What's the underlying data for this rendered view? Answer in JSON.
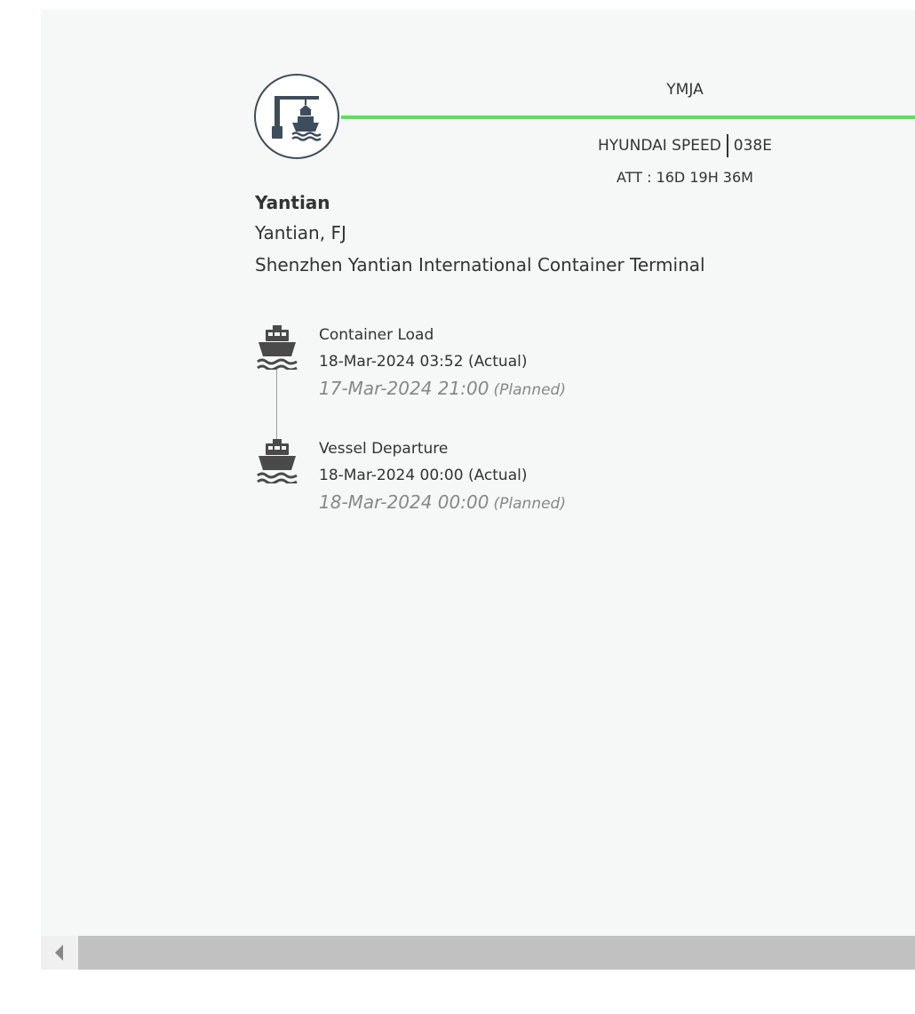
{
  "route": {
    "service_code": "YMJA",
    "vessel_name": "HYUNDAI SPEED",
    "voyage": "038E",
    "att": "ATT : 16D 19H 36M",
    "line_color": "#5ae25a"
  },
  "origin": {
    "icon": "port-crane-ship-icon",
    "name": "Yantian",
    "city": "Yantian, FJ",
    "terminal": "Shenzhen Yantian International Container Terminal"
  },
  "events": [
    {
      "icon": "ship-icon",
      "title": "Container Load",
      "actual": "18-Mar-2024 03:52 (Actual)",
      "planned_date": "17-Mar-2024 21:00",
      "planned_tag": "(Planned)"
    },
    {
      "icon": "ship-icon",
      "title": "Vessel Departure",
      "actual": "18-Mar-2024 00:00 (Actual)",
      "planned_date": "18-Mar-2024 00:00",
      "planned_tag": "(Planned)"
    }
  ],
  "colors": {
    "icon_dark": "#3d4d5c",
    "panel_bg": "#f6f7f7",
    "planned_text": "#888888"
  }
}
